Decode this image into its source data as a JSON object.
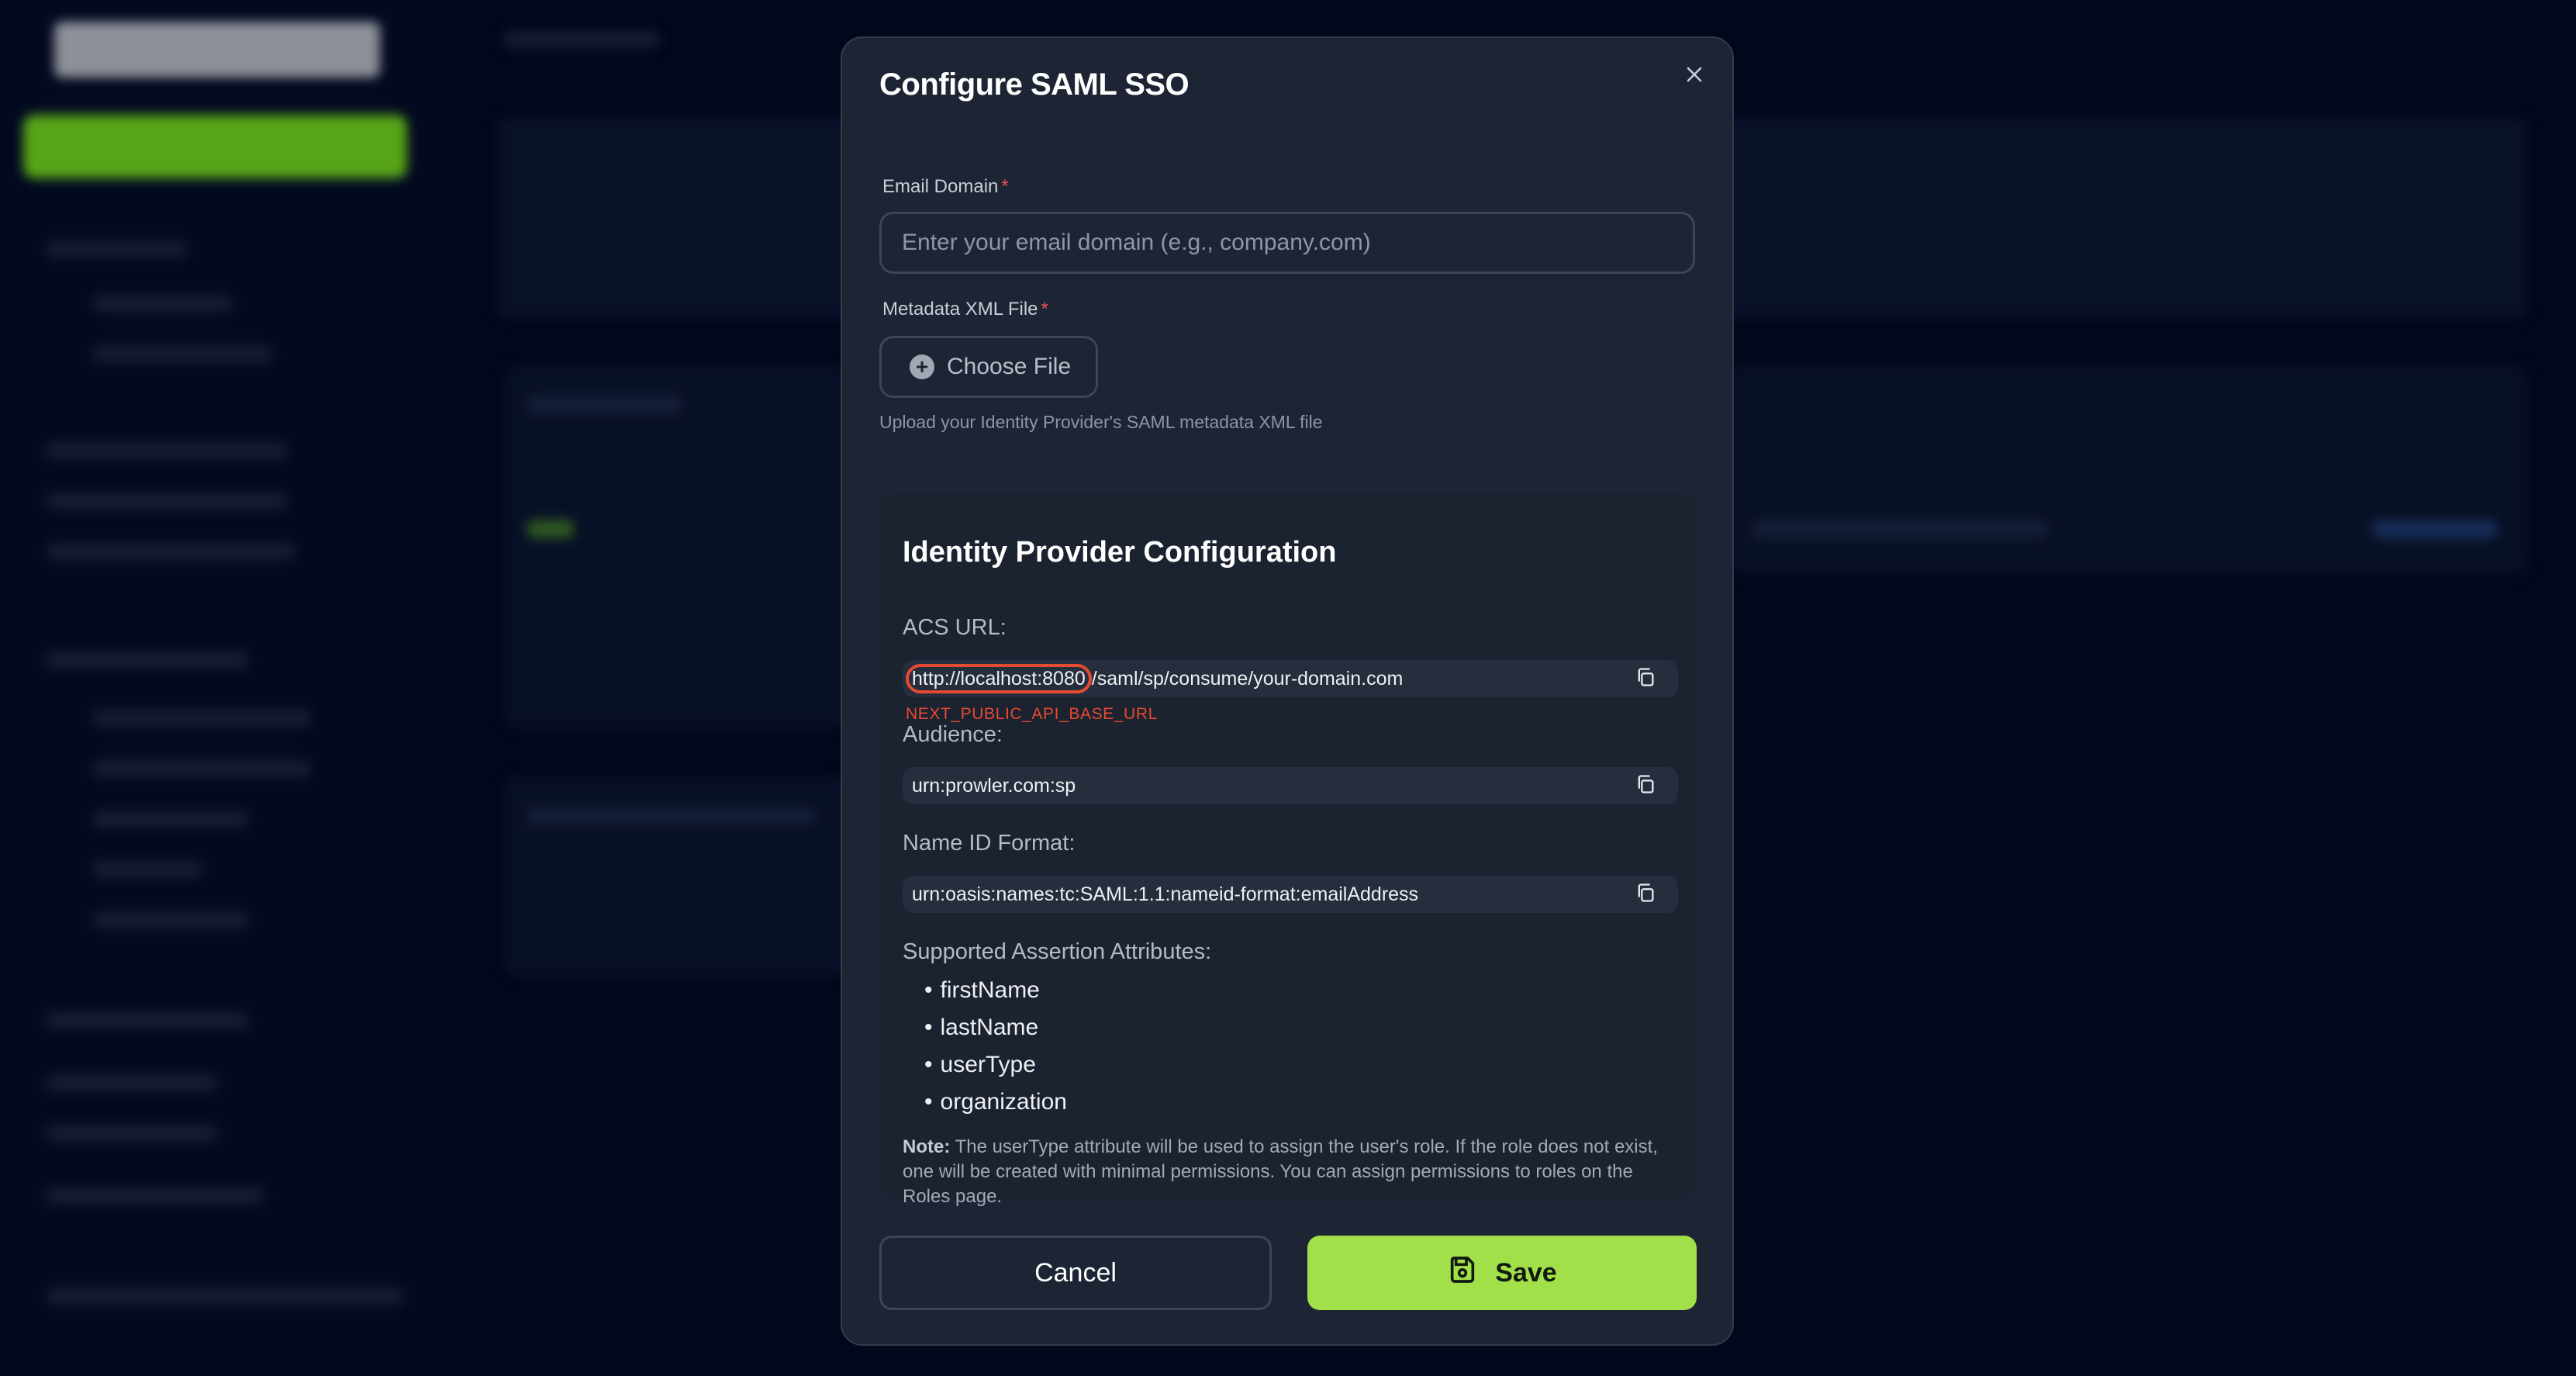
{
  "modal": {
    "title": "Configure SAML SSO",
    "close_icon": "close-icon"
  },
  "email_domain": {
    "label": "Email Domain",
    "required_mark": "*",
    "placeholder": "Enter your email domain (e.g., company.com)",
    "value": ""
  },
  "metadata_file": {
    "label": "Metadata XML File",
    "required_mark": "*",
    "button_label": "Choose File",
    "icon": "plus-circle-icon",
    "hint": "Upload your Identity Provider's SAML metadata XML file"
  },
  "idp_config": {
    "title": "Identity Provider Configuration",
    "acs_url": {
      "label": "ACS URL:",
      "value_highlighted": "http://localhost:8080",
      "value_rest": "/saml/sp/consume/your-domain.com",
      "annotation": "NEXT_PUBLIC_API_BASE_URL",
      "copy_icon": "copy-icon"
    },
    "audience": {
      "label": "Audience:",
      "value": "urn:prowler.com:sp",
      "copy_icon": "copy-icon"
    },
    "name_id_format": {
      "label": "Name ID Format:",
      "value": "urn:oasis:names:tc:SAML:1.1:nameid-format:emailAddress",
      "copy_icon": "copy-icon"
    },
    "attributes": {
      "label": "Supported Assertion Attributes:",
      "items": [
        "firstName",
        "lastName",
        "userType",
        "organization"
      ]
    },
    "note": {
      "prefix": "Note:",
      "text": "The userType attribute will be used to assign the user's role. If the role does not exist, one will be created with minimal permissions. You can assign permissions to roles on the Roles page."
    }
  },
  "actions": {
    "cancel_label": "Cancel",
    "save_label": "Save",
    "save_icon": "save-icon"
  },
  "colors": {
    "overlay_bg": "#030b24",
    "modal_bg": "#1d2534",
    "accent_green": "#a2e04a",
    "highlight_red": "#e64a32",
    "required_red": "#f05252"
  }
}
